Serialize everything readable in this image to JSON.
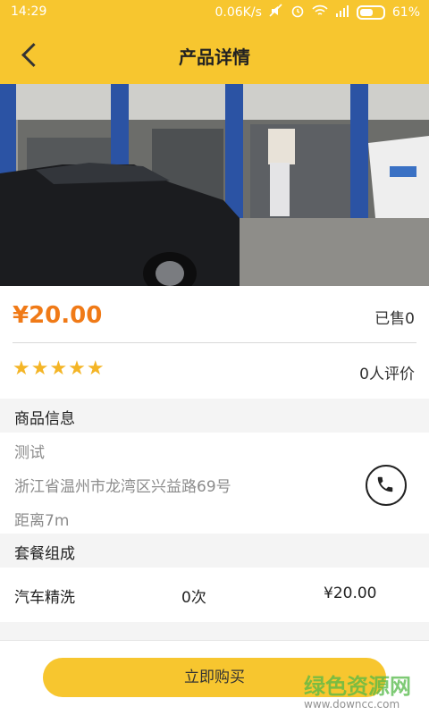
{
  "status": {
    "time": "14:29",
    "network_speed": "0.06K/s",
    "battery": "61%",
    "icons": [
      "mute-icon",
      "alarm-icon",
      "wifi-icon",
      "signal-icon",
      "battery-icon"
    ]
  },
  "header": {
    "title": "产品详情"
  },
  "product": {
    "price": "¥20.00",
    "sold": "已售0",
    "stars": "★★★★★",
    "reviews": "0人评价"
  },
  "info": {
    "section_title": "商品信息",
    "name": "测试",
    "address": "浙江省温州市龙湾区兴益路69号",
    "distance": "距离7m"
  },
  "package": {
    "section_title": "套餐组成",
    "items": [
      {
        "name": "汽车精洗",
        "count": "0次",
        "price": "¥20.00"
      }
    ]
  },
  "actions": {
    "buy_label": "立即购买"
  },
  "watermark": {
    "text": "绿色资源网",
    "url": "www.downcc.com"
  },
  "colors": {
    "accent": "#f7c62f",
    "price": "#f07a17",
    "star": "#f4b526"
  }
}
